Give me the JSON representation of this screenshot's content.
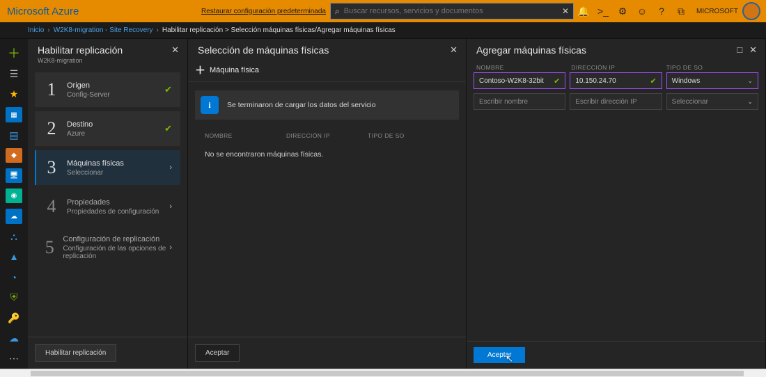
{
  "topbar": {
    "brand": "Microsoft Azure",
    "restore": "Restaurar configuración predeterminada",
    "search_placeholder": "Buscar recursos, servicios y documentos",
    "account_line1": "",
    "account_line2": "MICROSOFT"
  },
  "breadcrumbs": {
    "home": "Inicio",
    "l1": "W2K8-migration - Site Recovery",
    "l2": "Habilitar replicación > Selección máquinas físicas/Agregar máquinas físicas"
  },
  "blade1": {
    "title": "Habilitar replicación",
    "subtitle": "W2K8-migration",
    "steps": [
      {
        "num": "1",
        "l1": "Origen",
        "l2": "Config-Server",
        "done": true
      },
      {
        "num": "2",
        "l1": "Destino",
        "l2": "Azure",
        "done": true
      },
      {
        "num": "3",
        "l1": "Máquinas físicas",
        "l2": "Seleccionar",
        "active": true
      },
      {
        "num": "4",
        "l1": "Propiedades",
        "l2": "Propiedades de configuración"
      },
      {
        "num": "5",
        "l1": "Configuración de replicación",
        "l2": "Configuración de las opciones de replicación"
      }
    ],
    "footer_btn": "Habilitar replicación"
  },
  "blade2": {
    "title": "Selección de máquinas físicas",
    "add_label": "Máquina física",
    "info": "Se terminaron de cargar los datos del servicio",
    "col_name": "NOMBRE",
    "col_ip": "DIRECCIÓN IP",
    "col_os": "TIPO DE SO",
    "empty": "No se encontraron máquinas físicas.",
    "footer_btn": "Aceptar"
  },
  "blade3": {
    "title": "Agregar máquinas físicas",
    "col_name": "NOMBRE",
    "col_ip": "DIRECCIÓN IP",
    "col_os": "TIPO DE SO",
    "row1": {
      "name": "Contoso-W2K8-32bit",
      "ip": "10.150.24.70",
      "os": "Windows"
    },
    "row2": {
      "name_ph": "Escribir nombre",
      "ip_ph": "Escribir dirección IP",
      "os_ph": "Seleccionar"
    },
    "footer_btn": "Aceptar"
  }
}
